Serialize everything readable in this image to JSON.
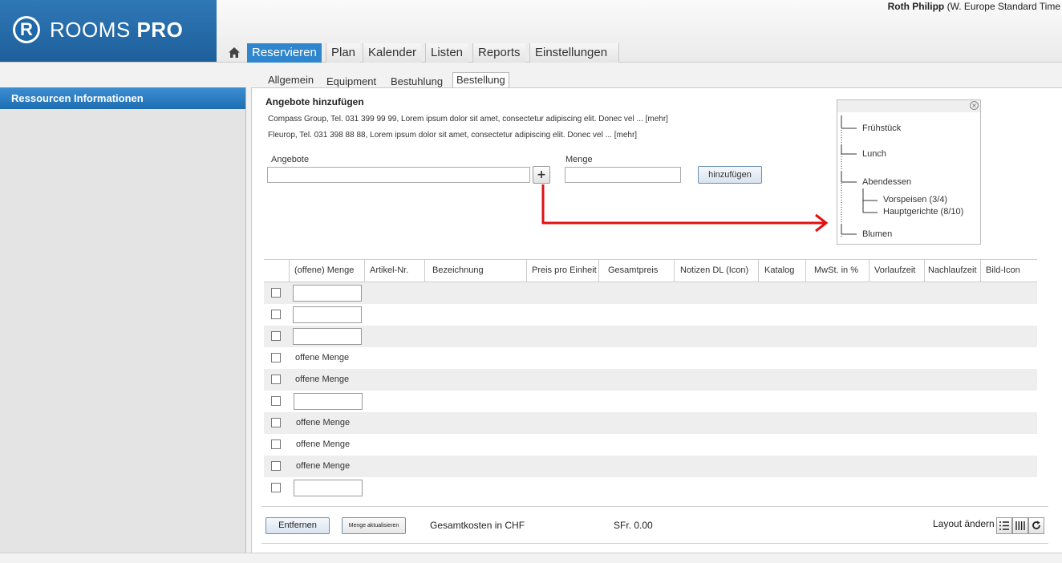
{
  "header": {
    "logo_letter": "R",
    "logo_text_light": "ROOMS",
    "logo_text_bold": "PRO",
    "user_name": "Roth Philipp",
    "user_timezone": "(W. Europe Standard Time"
  },
  "nav": {
    "home_icon": "home-icon",
    "tabs": [
      {
        "label": "Reservieren",
        "active": true
      },
      {
        "label": "Plan"
      },
      {
        "label": "Kalender"
      },
      {
        "label": "Listen"
      },
      {
        "label": "Reports"
      },
      {
        "label": "Einstellungen"
      }
    ]
  },
  "sidebar": {
    "title": "Ressourcen Informationen"
  },
  "subtabs": [
    {
      "label": "Allgemein"
    },
    {
      "label": "Equipment"
    },
    {
      "label": "Bestuhlung"
    },
    {
      "label": "Bestellung",
      "active": true
    }
  ],
  "offers": {
    "title": "Angebote hinzufügen",
    "lines": [
      "Compass Group, Tel. 031 399 99 99, Lorem ipsum dolor sit amet, consectetur adipiscing elit. Donec vel ... [mehr]",
      "Fleurop, Tel. 031 398 88 88, Lorem ipsum dolor sit amet, consectetur adipiscing elit. Donec vel ... [mehr]"
    ],
    "angebote_label": "Angebote",
    "angebote_value": "",
    "plus_label": "+",
    "menge_label": "Menge",
    "menge_value": "",
    "add_button": "hinzufügen"
  },
  "tree": {
    "close_icon": "close-icon",
    "items": [
      "Frühstück",
      "Lunch",
      "Abendessen",
      "Vorspeisen (3/4)",
      "Hauptgerichte (8/10)",
      "Blumen"
    ]
  },
  "table": {
    "columns": [
      "(offene) Menge",
      "Artikel-Nr.",
      "Bezeichnung",
      "Preis pro Einheit",
      "Gesamtpreis",
      "Notizen DL  (Icon)",
      "Katalog",
      "MwSt. in %",
      "Vorlaufzeit",
      "Nachlaufzeit",
      "Bild-Icon"
    ],
    "rows": [
      {
        "type": "input",
        "value": ""
      },
      {
        "type": "input",
        "value": ""
      },
      {
        "type": "input",
        "value": ""
      },
      {
        "type": "text",
        "value": "offene Menge"
      },
      {
        "type": "text",
        "value": "offene Menge"
      },
      {
        "type": "input",
        "value": ""
      },
      {
        "type": "text",
        "value": "offene Menge"
      },
      {
        "type": "text",
        "value": "offene Menge"
      },
      {
        "type": "text",
        "value": "offene Menge"
      },
      {
        "type": "input",
        "value": ""
      }
    ]
  },
  "footer": {
    "remove_button": "Entfernen",
    "update_button": "Menge aktualisieren",
    "total_label": "Gesamtkosten in CHF",
    "total_value": "SFr. 0.00",
    "layout_label": "Layout ändern",
    "layout_icons": [
      "list-icon",
      "columns-icon",
      "refresh-icon"
    ]
  },
  "colors": {
    "accent": "#2f86cc",
    "arrow": "#e01010"
  }
}
